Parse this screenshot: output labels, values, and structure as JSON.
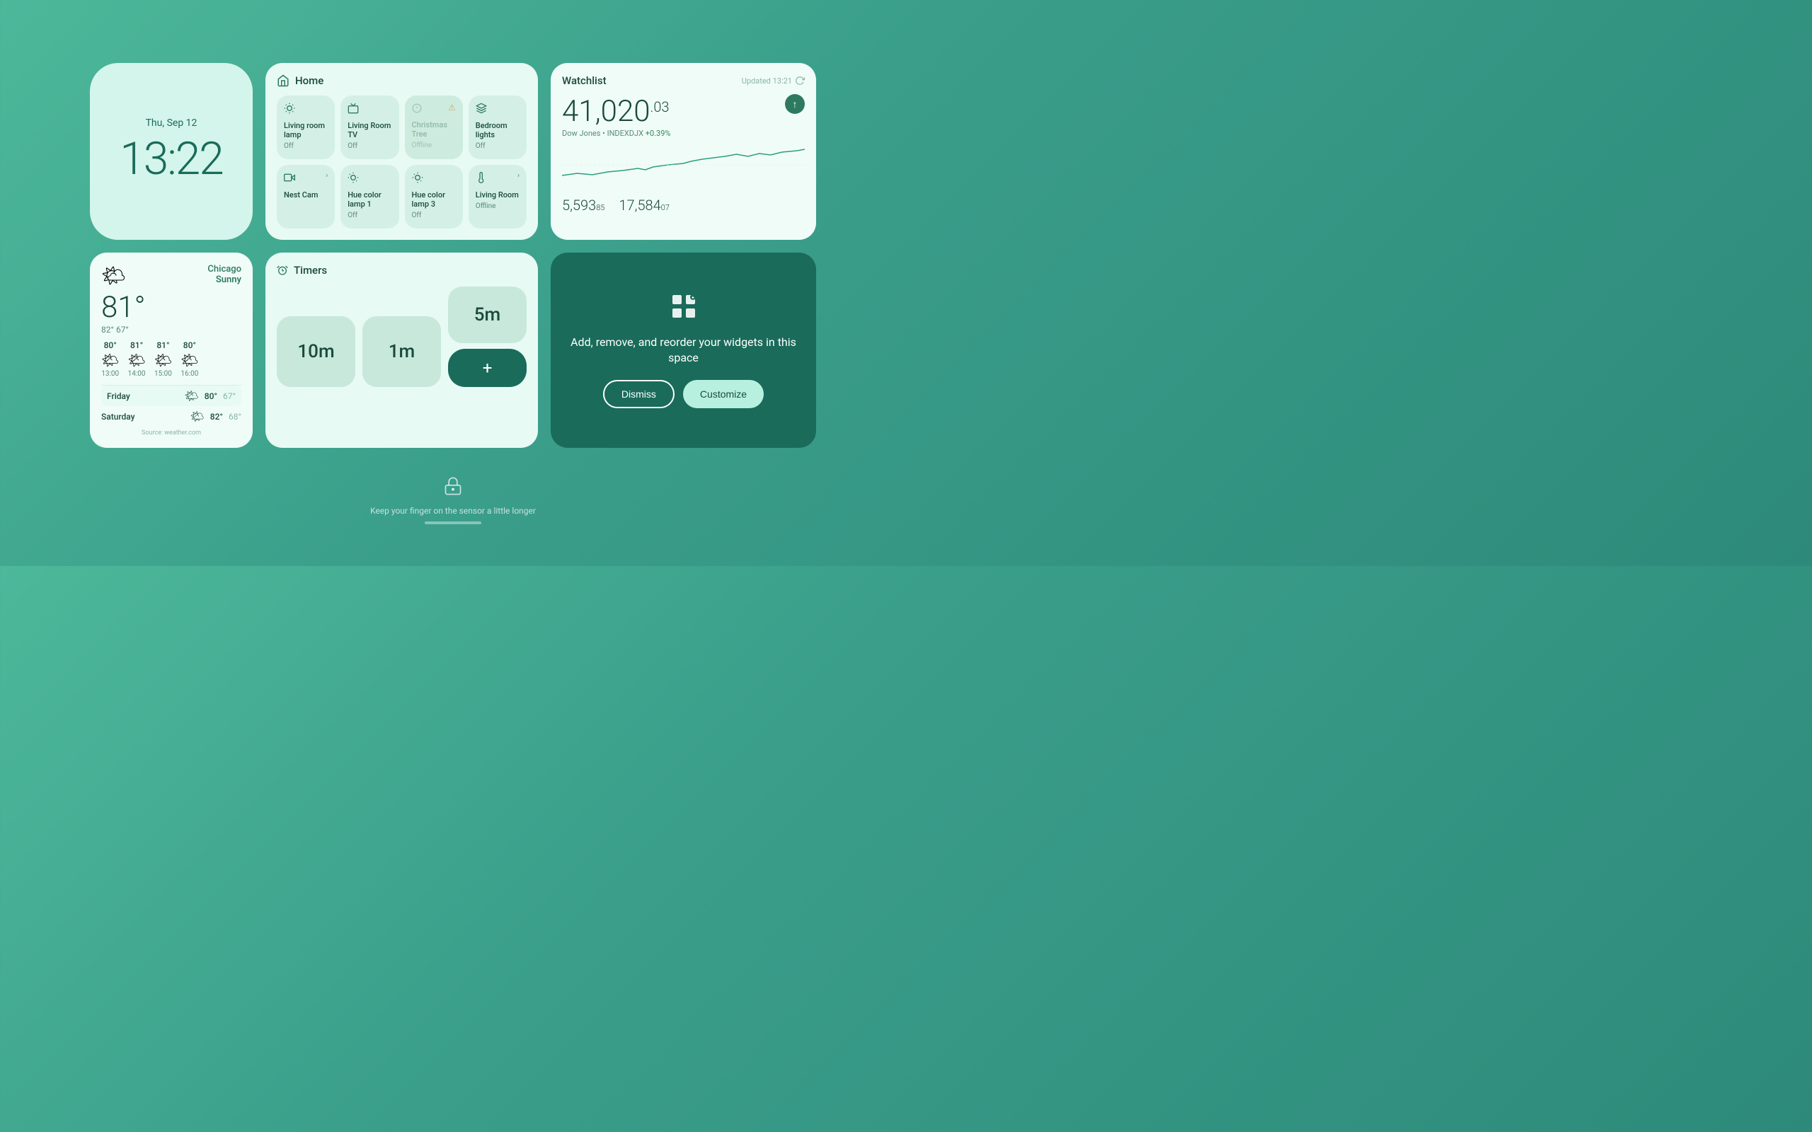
{
  "clock": {
    "date": "Thu, Sep 12",
    "time": "13:22"
  },
  "home_widget": {
    "title": "Home",
    "devices": [
      {
        "name": "Living room lamp",
        "status": "Off",
        "icon": "💡",
        "offline": false
      },
      {
        "name": "Living Room TV",
        "status": "Off",
        "icon": "📺",
        "offline": false
      },
      {
        "name": "Christmas Tree",
        "status": "Offline",
        "icon": "⏱",
        "offline": true,
        "warning": true
      },
      {
        "name": "Bedroom lights",
        "status": "Off",
        "icon": "🔆",
        "offline": false
      },
      {
        "name": "Nest Cam",
        "status": "",
        "icon": "📷",
        "offline": false,
        "hasChevron": true
      },
      {
        "name": "Hue color lamp 1",
        "status": "Off",
        "icon": "💡",
        "offline": false
      },
      {
        "name": "Hue color lamp 3",
        "status": "Off",
        "icon": "💡",
        "offline": false
      },
      {
        "name": "Living Room",
        "status": "Offline",
        "icon": "🌡",
        "offline": false,
        "hasChevron": true
      }
    ]
  },
  "watchlist": {
    "title": "Watchlist",
    "updated": "Updated 13:21",
    "price_main": "41,020",
    "price_decimal": ".03",
    "index": "Dow Jones • INDEXDJX",
    "change": "+0.39%",
    "stock1_value": "5,593",
    "stock1_decimal": "85",
    "stock2_value": "17,584",
    "stock2_decimal": "07"
  },
  "weather": {
    "city": "Chicago",
    "condition": "Sunny",
    "temp": "81°",
    "range": "82° 67°",
    "hourly": [
      {
        "temp": "80°",
        "time": "13:00"
      },
      {
        "temp": "81°",
        "time": "14:00"
      },
      {
        "temp": "81°",
        "time": "15:00"
      },
      {
        "temp": "80°",
        "time": "16:00"
      }
    ],
    "daily": [
      {
        "day": "Friday",
        "high": "80°",
        "low": "67°"
      },
      {
        "day": "Saturday",
        "high": "82°",
        "low": "68°"
      }
    ],
    "source": "Source: weather.com"
  },
  "timers": {
    "title": "Timers",
    "timer1": "10m",
    "timer2": "1m",
    "timer3": "5m",
    "add_label": "+"
  },
  "customize": {
    "text": "Add, remove, and reorder your widgets in this space",
    "dismiss_label": "Dismiss",
    "customize_label": "Customize"
  },
  "bottom": {
    "text": "Keep your finger on the sensor a little longer"
  }
}
